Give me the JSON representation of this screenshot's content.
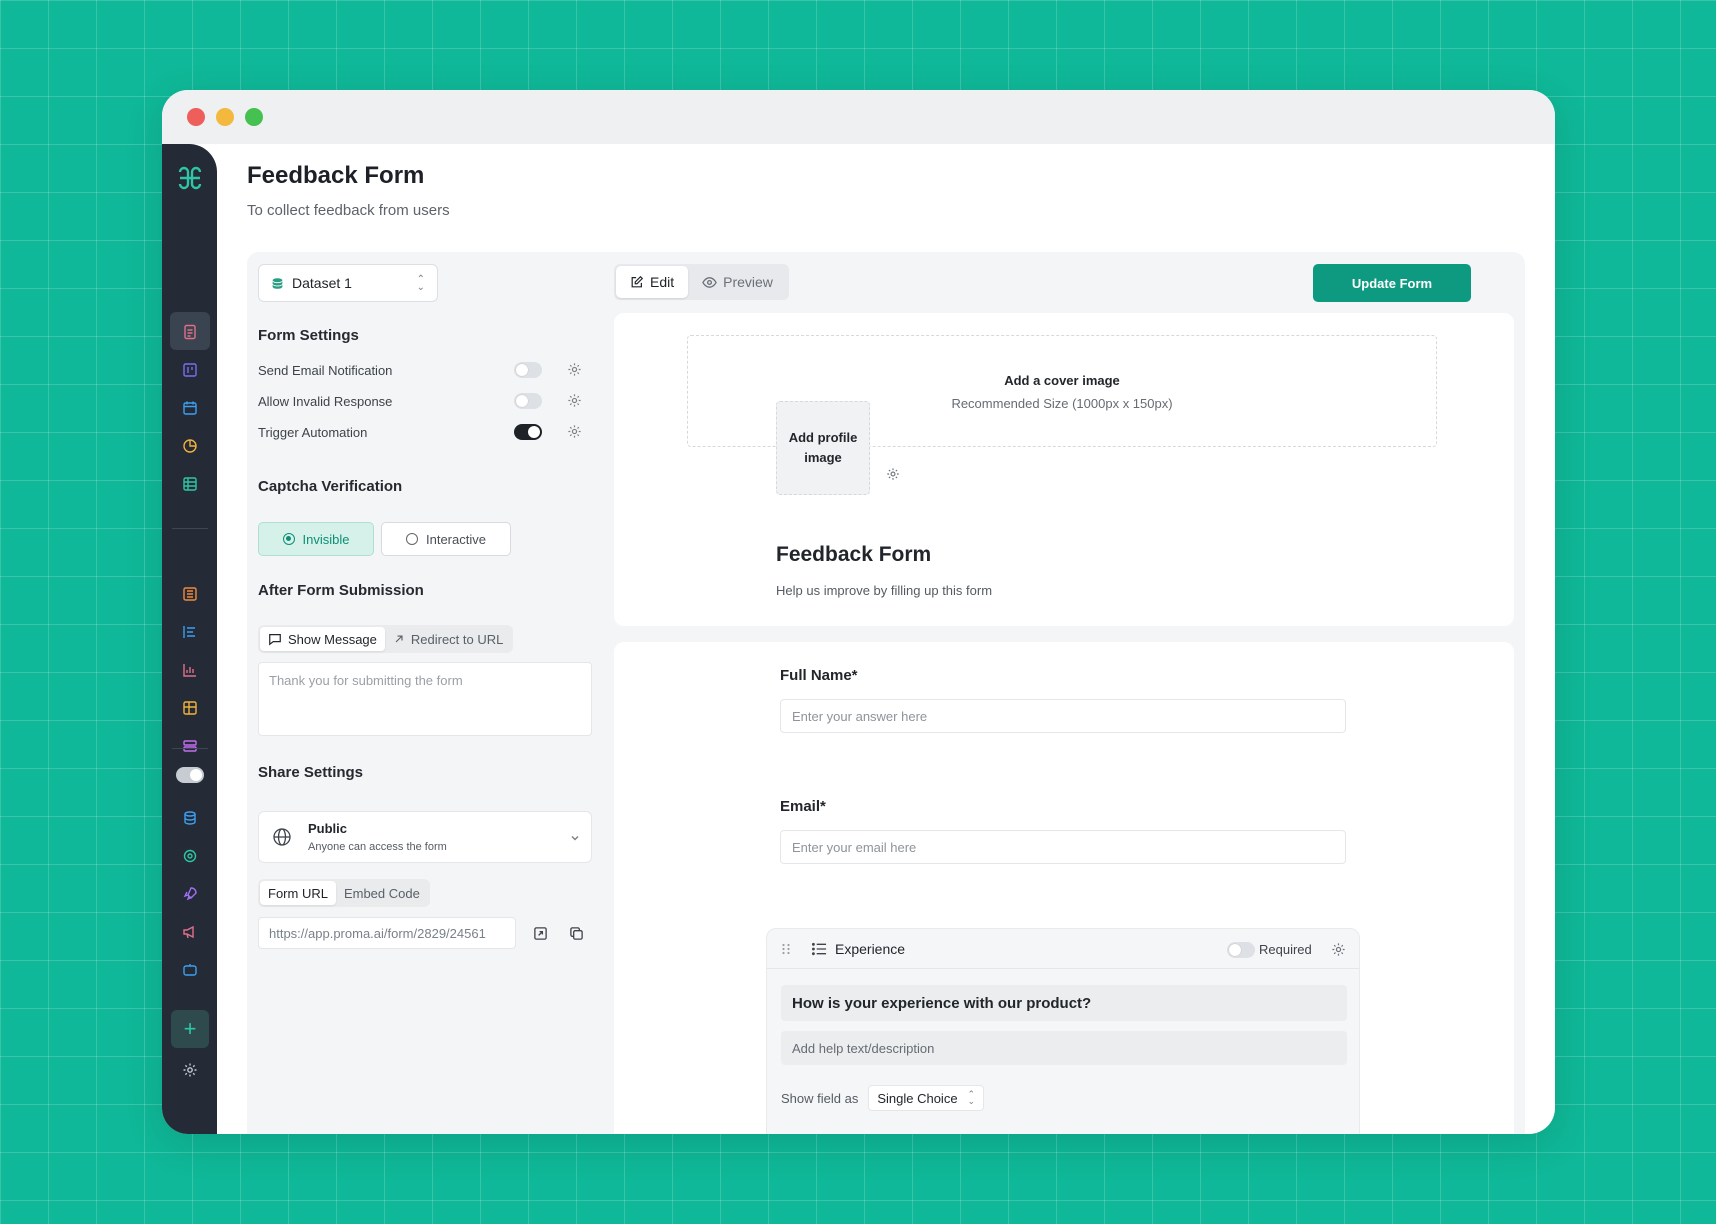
{
  "page": {
    "title": "Feedback Form",
    "subtitle": "To collect feedback from users"
  },
  "sidebar": {
    "icons": [
      "forms-icon",
      "board-icon",
      "calendar-icon",
      "chart-pie-icon",
      "table-icon",
      "list-icon",
      "list-bars-icon",
      "bar-chart-icon",
      "grid-icon",
      "stack-icon",
      "database-icon",
      "integration-icon",
      "rocket-icon",
      "megaphone-icon",
      "chatbot-icon"
    ],
    "add_label": "+"
  },
  "left": {
    "dataset": "Dataset 1",
    "form_settings_title": "Form Settings",
    "settings": [
      {
        "label": "Send Email Notification",
        "on": false
      },
      {
        "label": "Allow Invalid Response",
        "on": false
      },
      {
        "label": "Trigger Automation",
        "on": true
      }
    ],
    "captcha_title": "Captcha Verification",
    "captcha_invisible": "Invisible",
    "captcha_interactive": "Interactive",
    "after_title": "After Form Submission",
    "show_message": "Show Message",
    "redirect_url": "Redirect to URL",
    "message_placeholder": "Thank you for submitting the form",
    "share_title": "Share Settings",
    "share_mode": "Public",
    "share_desc": "Anyone can access the form",
    "form_url_tab": "Form URL",
    "embed_tab": "Embed Code",
    "form_url": "https://app.proma.ai/form/2829/24561"
  },
  "editor": {
    "edit_tab": "Edit",
    "preview_tab": "Preview",
    "update_button": "Update Form",
    "cover_title": "Add a cover image",
    "cover_size": "Recommended Size (1000px x 150px)",
    "profile_label": "Add profile image",
    "form_title": "Feedback Form",
    "form_desc": "Help us improve by filling up this form"
  },
  "fields": {
    "full_name_label": "Full Name*",
    "full_name_placeholder": "Enter your answer here",
    "email_label": "Email*",
    "email_placeholder": "Enter your email here",
    "experience": {
      "type_label": "Experience",
      "required_label": "Required",
      "question": "How is your experience with our product?",
      "help_placeholder": "Add help text/description",
      "show_as_label": "Show field as",
      "show_as_value": "Single Choice"
    }
  },
  "colors": {
    "background": "#0fb898",
    "accent": "#0e9a80",
    "sidebar": "#242b36"
  }
}
